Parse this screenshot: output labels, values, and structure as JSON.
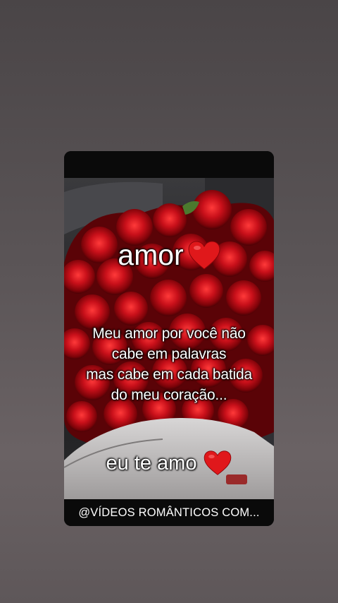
{
  "story": {
    "title": "amor",
    "title_icon": "red-heart-icon",
    "message_lines": [
      "Meu amor por você não",
      "cabe em palavras",
      "mas cabe em cada batida",
      "do meu coração..."
    ],
    "closing": "eu te amo",
    "closing_icon": "red-heart-icon",
    "watermark": "@VÍDEOS ROMÂNTICOS COM..."
  },
  "colors": {
    "heart": "#e0181b",
    "rose": "#b80d14",
    "page_background": "#5b5557"
  }
}
